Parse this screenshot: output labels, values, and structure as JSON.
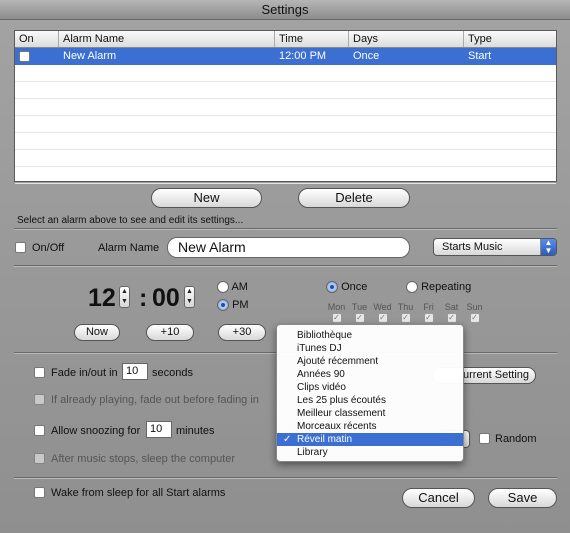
{
  "window": {
    "title": "Settings"
  },
  "alarms_table": {
    "headers": [
      "On",
      "Alarm Name",
      "Time",
      "Days",
      "Type"
    ],
    "rows": [
      {
        "name": "New Alarm",
        "time": "12:00 PM",
        "days": "Once",
        "type": "Start",
        "on": false,
        "selected": true
      }
    ]
  },
  "buttons": {
    "new": "New",
    "delete": "Delete",
    "now": "Now",
    "plus10": "+10",
    "plus30": "+30",
    "current_setting": "urrent Setting",
    "cancel": "Cancel",
    "save": "Save"
  },
  "hint": "Select an alarm above to see and edit its settings...",
  "editor": {
    "onoff_label": "On/Off",
    "alarm_name_label": "Alarm Name",
    "alarm_name_value": "New Alarm",
    "action_popup": "Starts Music",
    "hour": "12",
    "minute": "00",
    "colon": ":",
    "am": "AM",
    "pm": "PM",
    "once": "Once",
    "repeating": "Repeating",
    "days": [
      "Mon",
      "Tue",
      "Wed",
      "Thu",
      "Fri",
      "Sat",
      "Sun"
    ]
  },
  "options": {
    "fade_label": "Fade in/out in",
    "fade_value": "10",
    "fade_unit": "seconds",
    "already_playing": "If already playing, fade out before fading in",
    "snooze_label": "Allow snoozing for",
    "snooze_value": "10",
    "snooze_unit": "minutes",
    "after_music": "After music stops, sleep the computer",
    "random": "Random",
    "wake": "Wake from sleep for all Start alarms"
  },
  "playlist_menu": {
    "items": [
      "Bibliothèque",
      "iTunes DJ",
      "Ajouté récemment",
      "Années 90",
      "Clips vidéo",
      "Les 25 plus écoutés",
      "Meilleur classement",
      "Morceaux récents",
      "Réveil matin",
      "Library"
    ],
    "selected": "Réveil matin",
    "check_glyph": "✓"
  },
  "colors": {
    "selection": "#3b6fd1",
    "window_bg": "#9a9a9a"
  }
}
